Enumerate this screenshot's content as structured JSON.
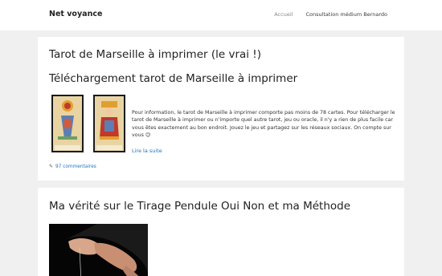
{
  "site": {
    "title": "Net voyance"
  },
  "nav": {
    "items": [
      "Accueil",
      "Consultation médium Bernardo"
    ]
  },
  "posts": [
    {
      "title": "Tarot de Marseille à imprimer (le vrai !)",
      "heading": "Téléchargement tarot de Marseille à imprimer",
      "excerpt": "Pour information, le tarot de Marseille à imprimer comporte pas moins de 78 cartes. Pour télécharger le tarot de Marseille à imprimer ou n'importe quel autre tarot, jeu ou oracle, il n'y a rien de plus facile car vous êtes exactement au bon endroit. Jouez le jeu et partagez sur les réseaux sociaux. On compte sur vous 😉",
      "read_more": "Lire la suite",
      "comments": "97 commentaires"
    },
    {
      "title": "Ma vérité sur le Tirage Pendule Oui Non et ma Méthode"
    }
  ],
  "icons": {
    "comments": "comment-bubble-icon"
  },
  "colors": {
    "link": "#1e73be",
    "background": "#f0f0f0"
  }
}
